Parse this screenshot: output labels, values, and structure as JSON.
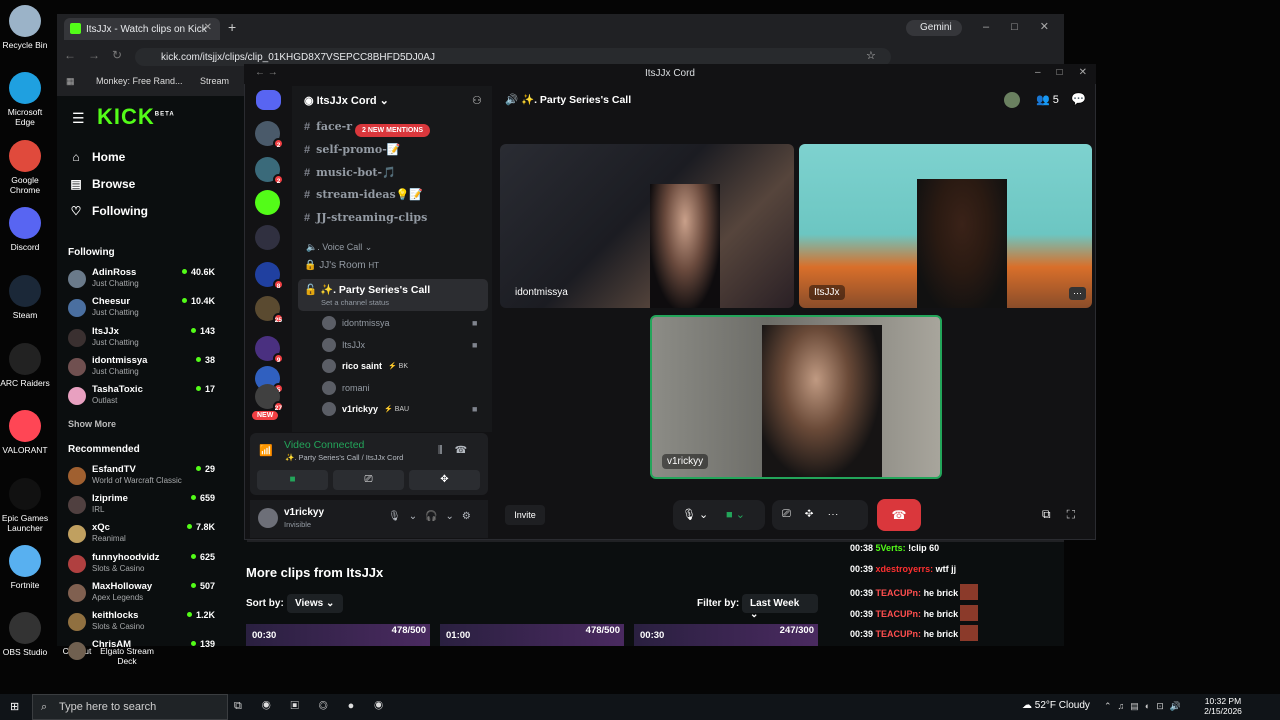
{
  "desktop": {
    "icons": [
      {
        "label": "Recycle Bin",
        "name": "recycle-bin-icon",
        "color": "#9bb3c8"
      },
      {
        "label": "Microsoft Edge",
        "name": "edge-icon",
        "color": "#1fa0e0"
      },
      {
        "label": "Google Chrome",
        "name": "chrome-icon",
        "color": "#e04a3c"
      },
      {
        "label": "Discord",
        "name": "discord-icon",
        "color": "#5865f2"
      },
      {
        "label": "Steam",
        "name": "steam-icon",
        "color": "#1b2838"
      },
      {
        "label": "ARC Raiders",
        "name": "arc-raiders-icon",
        "color": "#222"
      },
      {
        "label": "VALORANT",
        "name": "valorant-icon",
        "color": "#ff4655"
      },
      {
        "label": "Epic Games Launcher",
        "name": "epic-icon",
        "color": "#111"
      },
      {
        "label": "Fortnite",
        "name": "fortnite-icon",
        "color": "#58b0f0"
      },
      {
        "label": "OBS Studio",
        "name": "obs-icon",
        "color": "#333"
      }
    ],
    "bottom_labels": [
      "CapCut",
      "Elgato Stream Deck"
    ]
  },
  "chrome": {
    "tab_title": "ItsJJx - Watch clips on Kick",
    "gemini": "Gemini",
    "url": "kick.com/itsjjx/clips/clip_01KHGD8X7VSEPCC8BHFD5DJ0AJ",
    "bookmarks": [
      "Monkey: Free Rand...",
      "Stream"
    ]
  },
  "kick": {
    "logo": "KICK",
    "beta": "BETA",
    "nav": [
      "Home",
      "Browse",
      "Following"
    ],
    "following_title": "Following",
    "following": [
      {
        "name": "AdinRoss",
        "game": "Just Chatting",
        "viewers": "40.6K",
        "color": "#6a7a8a"
      },
      {
        "name": "Cheesur",
        "game": "Just Chatting",
        "viewers": "10.4K",
        "color": "#4a6fa0"
      },
      {
        "name": "ItsJJx",
        "game": "Just Chatting",
        "viewers": "143",
        "color": "#3a3030"
      },
      {
        "name": "idontmissya",
        "game": "Just Chatting",
        "viewers": "38",
        "color": "#705050"
      },
      {
        "name": "TashaToxic",
        "game": "Outlast",
        "viewers": "17",
        "color": "#e8a0c0"
      }
    ],
    "show_more": "Show More",
    "recommended_title": "Recommended",
    "recommended": [
      {
        "name": "EsfandTV",
        "game": "World of Warcraft Classic",
        "viewers": "29",
        "color": "#a06030"
      },
      {
        "name": "Iziprime",
        "game": "IRL",
        "viewers": "659",
        "color": "#504040"
      },
      {
        "name": "xQc",
        "game": "Reanimal",
        "viewers": "7.8K",
        "color": "#c0a060"
      },
      {
        "name": "funnyhoodvidz",
        "game": "Slots & Casino",
        "viewers": "625",
        "color": "#b04040"
      },
      {
        "name": "MaxHolloway",
        "game": "Apex Legends",
        "viewers": "507",
        "color": "#806050"
      },
      {
        "name": "keithlocks",
        "game": "Slots & Casino",
        "viewers": "1.2K",
        "color": "#907040"
      },
      {
        "name": "ChrisAM",
        "game": "",
        "viewers": "139",
        "color": "#706050"
      }
    ],
    "more_clips": "More clips from ItsJJx",
    "sort_label": "Sort by:",
    "sort_value": "Views",
    "filter_label": "Filter by:",
    "filter_value": "Last Week",
    "clips": [
      {
        "dur": "00:30",
        "views": "478/500"
      },
      {
        "dur": "01:00",
        "views": "478/500"
      },
      {
        "dur": "00:30",
        "views": "247/300"
      }
    ]
  },
  "chat": [
    {
      "time": "00:38",
      "user": "5Verts:",
      "msg": "!clip 60",
      "ucolor": "#53fc18"
    },
    {
      "time": "00:39",
      "user": "xdestroyerrs:",
      "msg": "wtf jj",
      "ucolor": "#ff3030"
    },
    {
      "time": "00:39",
      "user": "TEACUPn:",
      "msg": "he brick",
      "ucolor": "#ff4f4f"
    },
    {
      "time": "00:39",
      "user": "TEACUPn:",
      "msg": "he brick",
      "ucolor": "#ff4f4f"
    },
    {
      "time": "00:39",
      "user": "TEACUPn:",
      "msg": "he brick",
      "ucolor": "#ff4f4f"
    }
  ],
  "discord": {
    "window_title": "ItsJJx Cord",
    "server_name": "ItsJJx Cord",
    "mentions": "2 NEW MENTIONS",
    "channels": [
      "face-r",
      "self-promo-📝",
      "music-bot-🎵",
      "stream-ideas💡📝",
      "JJ-streaming-clips"
    ],
    "voice_category": "Voice Call",
    "room1": "JJ's Room",
    "room1_tag": "HT",
    "room2": "✨. Party Series's Call",
    "room2_status": "Set a channel status",
    "voice_users": [
      {
        "name": "idontmissya",
        "tag": ""
      },
      {
        "name": "ItsJJx",
        "tag": ""
      },
      {
        "name": "rico saint",
        "tag": "BK"
      },
      {
        "name": "romani",
        "tag": ""
      },
      {
        "name": "v1rickyy",
        "tag": "BAU"
      }
    ],
    "guild_badges": [
      "2",
      "2",
      "8",
      "25",
      "9",
      "5",
      "27"
    ],
    "new": "NEW",
    "connected": "Video Connected",
    "connected_sub": "✨. Party Series's Call / ItsJJx Cord",
    "user": "v1rickyy",
    "user_status": "Invisible",
    "call_title": "✨. Party Series's Call",
    "participants": "5",
    "tiles": [
      "idontmissya",
      "ItsJJx",
      "v1rickyy"
    ],
    "invite": "Invite"
  },
  "taskbar": {
    "search": "Type here to search",
    "weather": "52°F  Cloudy",
    "time": "10:32 PM",
    "date": "2/15/2026"
  }
}
